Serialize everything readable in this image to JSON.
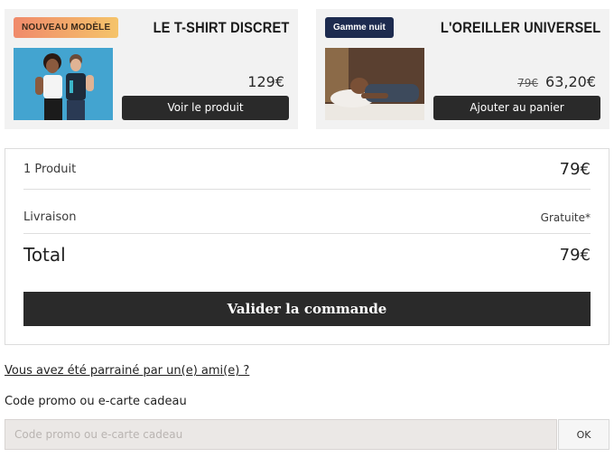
{
  "products": [
    {
      "badge": "NOUVEAU MODÈLE",
      "badge_color_start": "#f08a6b",
      "badge_color_end": "#f5c46a",
      "title": "LE T-SHIRT DISCRET",
      "price": "129€",
      "button_label": "Voir le produit",
      "image": "two-people-wearing-tshirts"
    },
    {
      "badge": "Gamme nuit",
      "badge_color": "#1d2b4f",
      "title": "L'OREILLER UNIVERSEL",
      "old_price": "79€",
      "price": "63,20€",
      "button_label": "Ajouter au panier",
      "image": "man-sleeping-on-pillow"
    }
  ],
  "summary": {
    "products_label": "1 Produit",
    "products_value": "79€",
    "shipping_label": "Livraison",
    "shipping_value": "Gratuite*",
    "total_label": "Total",
    "total_value": "79€",
    "validate_label": "Valider la commande"
  },
  "referral_link": "Vous avez été parrainé par un(e) ami(e) ?",
  "promo": {
    "label": "Code promo ou e-carte cadeau",
    "placeholder": "Code promo ou e-carte cadeau",
    "value": "",
    "ok_label": "OK"
  },
  "colors": {
    "dark_button": "#2a2a2a",
    "card_background": "#f2f2f2",
    "input_background": "#ebe8e6"
  }
}
